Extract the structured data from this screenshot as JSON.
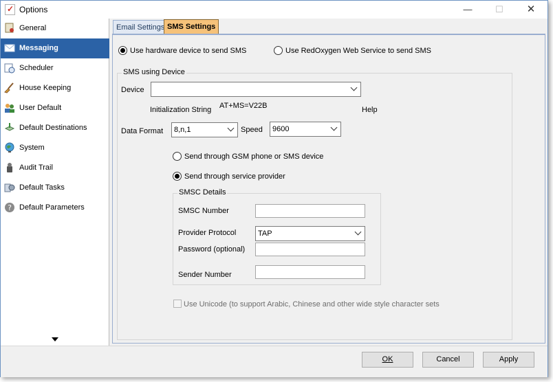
{
  "window": {
    "title": "Options",
    "minimize_glyph": "—",
    "maximize_glyph": "☐",
    "close_glyph": "✕"
  },
  "sidebar": {
    "items": [
      {
        "label": "General",
        "icon": "certificate-icon"
      },
      {
        "label": "Messaging",
        "icon": "envelope-icon",
        "active": true
      },
      {
        "label": "Scheduler",
        "icon": "calendar-clock-icon"
      },
      {
        "label": "House Keeping",
        "icon": "broom-icon"
      },
      {
        "label": "User Default",
        "icon": "users-icon"
      },
      {
        "label": "Default Destinations",
        "icon": "destination-icon"
      },
      {
        "label": "System",
        "icon": "globe-icon"
      },
      {
        "label": "Audit Trail",
        "icon": "audit-icon"
      },
      {
        "label": "Default Tasks",
        "icon": "tasks-icon"
      },
      {
        "label": "Default Parameters",
        "icon": "help-icon"
      }
    ]
  },
  "tabs": [
    {
      "label": "Email Settings"
    },
    {
      "label": "SMS Settings",
      "active": true
    }
  ],
  "sms": {
    "radio_hardware": "Use hardware device to send SMS",
    "radio_redoxygen": "Use RedOxygen Web Service  to send SMS",
    "device_group_title": "SMS using Device",
    "device_label": "Device",
    "device_value": "",
    "init_string_label": "Initialization String",
    "init_string_value": "AT+MS=V22B",
    "help_label": "Help",
    "data_format_label": "Data Format",
    "data_format_value": "8,n,1",
    "speed_label": "Speed",
    "speed_value": "9600",
    "radio_gsm": "Send through GSM phone or SMS device",
    "radio_provider": "Send through service provider",
    "smsc_group_title": "SMSC Details",
    "smsc_number_label": "SMSC Number",
    "smsc_number_value": "",
    "provider_protocol_label": "Provider Protocol",
    "provider_protocol_value": "TAP",
    "password_label": "Password (optional)",
    "password_value": "",
    "sender_number_label": "Sender Number",
    "sender_number_value": "",
    "unicode_label": "Use Unicode (to support Arabic, Chinese and other wide style character sets"
  },
  "footer": {
    "ok_label": "OK",
    "cancel_label": "Cancel",
    "apply_label": "Apply"
  },
  "colors": {
    "selection": "#2b62a6",
    "active_tab": "#f6c27a"
  }
}
